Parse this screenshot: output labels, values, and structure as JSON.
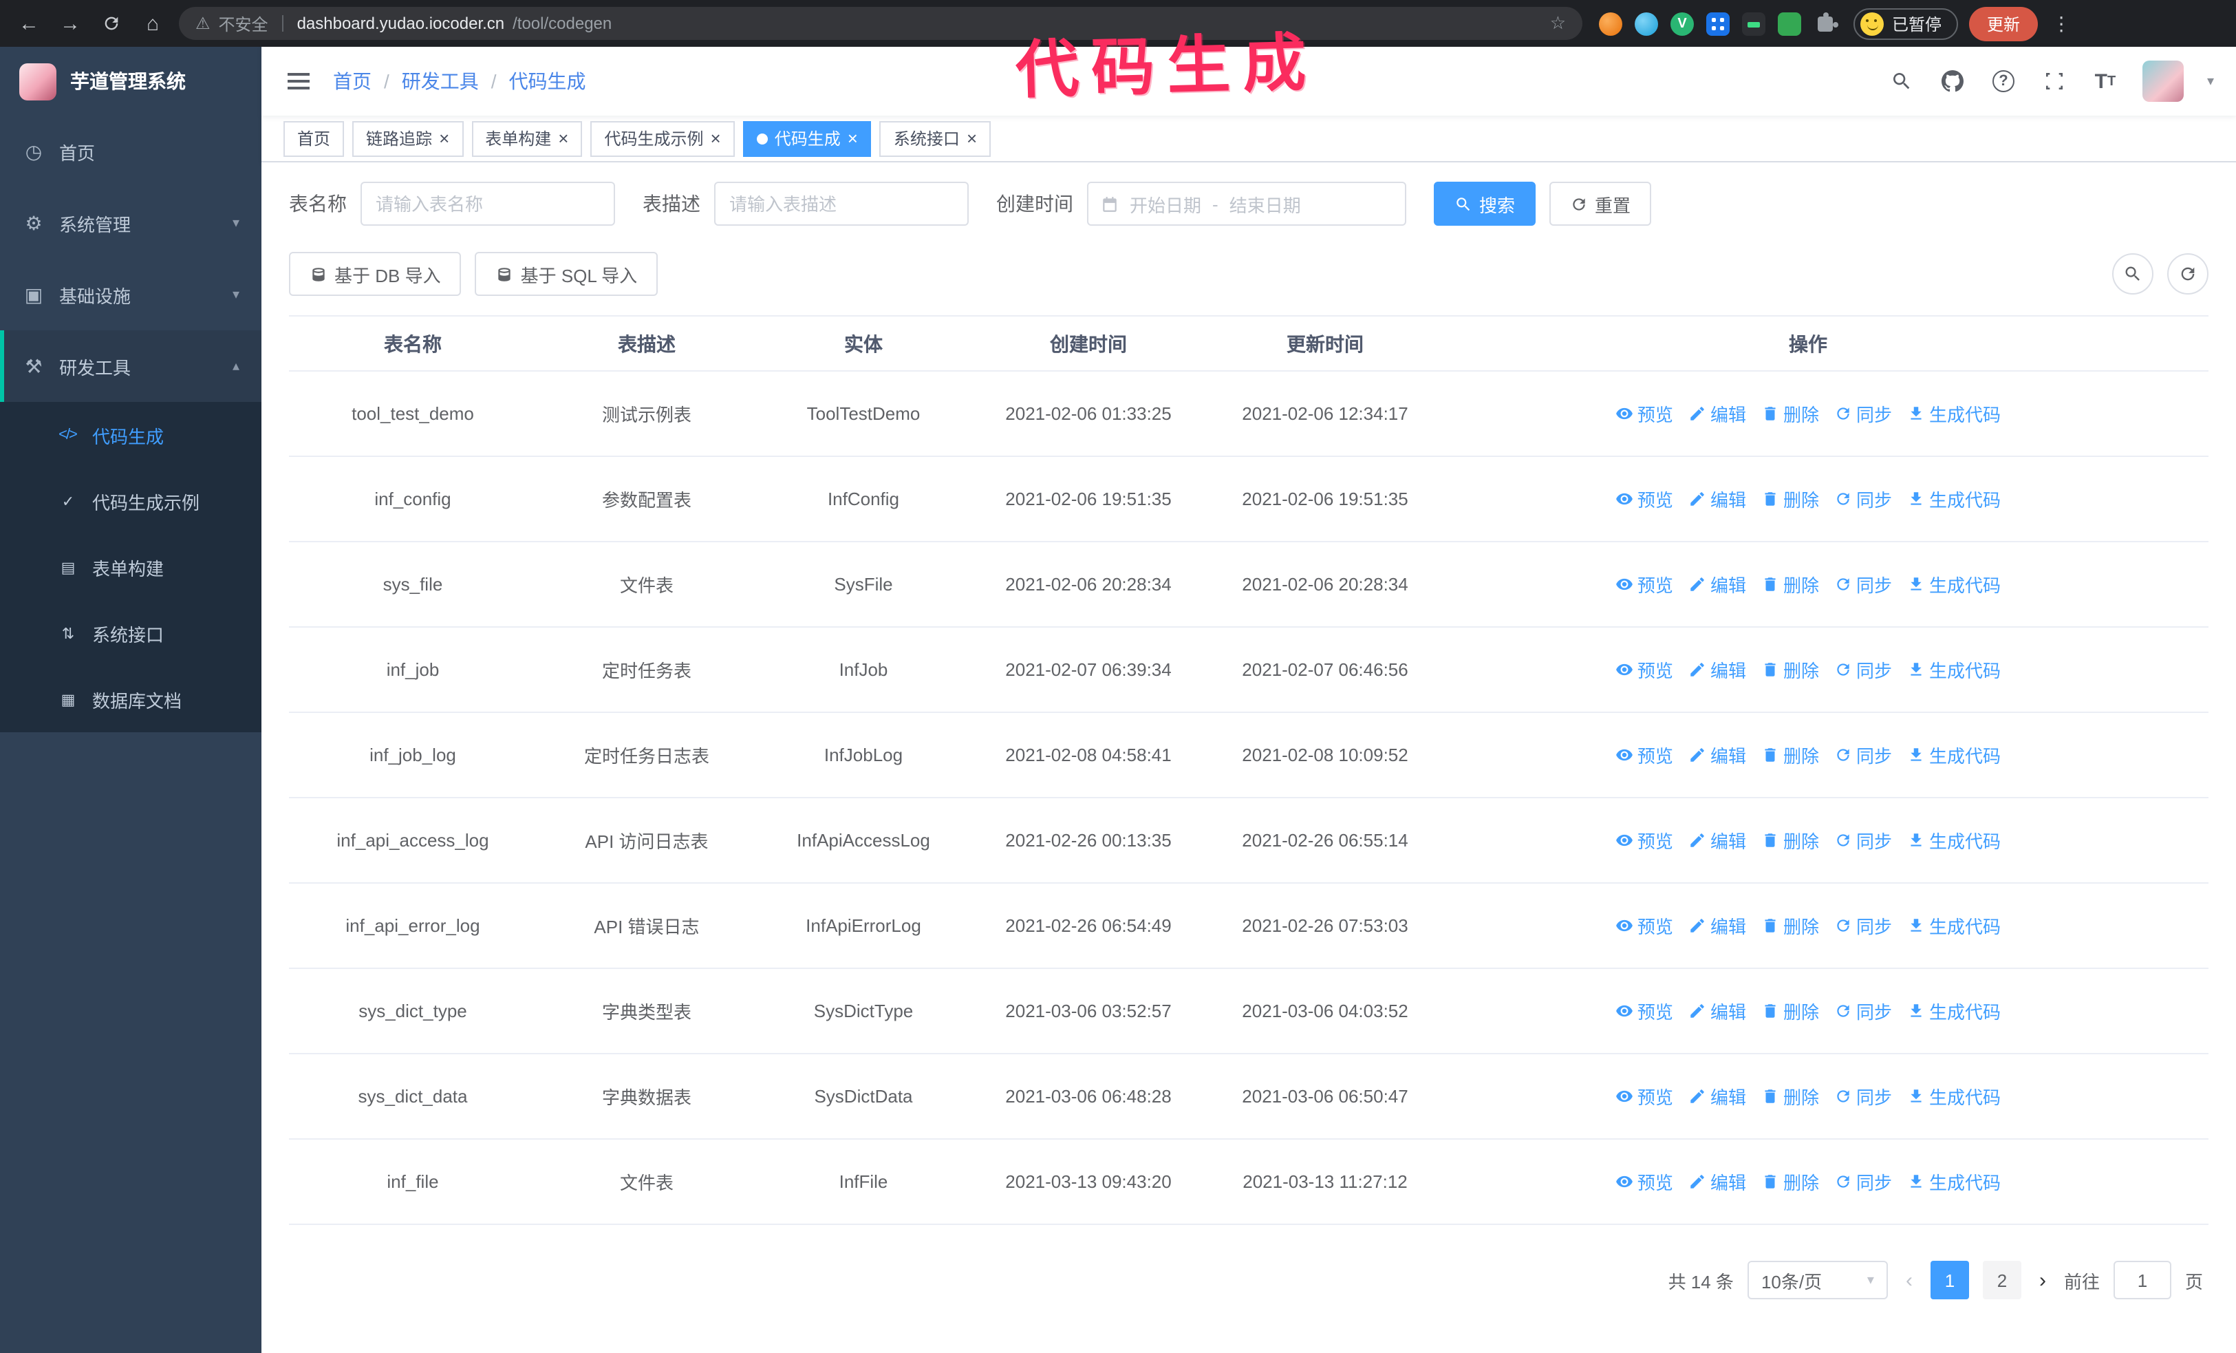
{
  "browser": {
    "security_chip": "不安全",
    "url_host": "dashboard.yudao.iocoder.cn",
    "url_path": "/tool/codegen",
    "paused_badge": "已暂停",
    "update_button": "更新"
  },
  "annotation": {
    "text": "代码生成",
    "color": "#fa2c5e"
  },
  "sidebar": {
    "logo_title": "芋道管理系统",
    "items": [
      {
        "key": "home",
        "label": "首页",
        "icon": "dashboard-icon"
      },
      {
        "key": "system",
        "label": "系统管理",
        "icon": "gear-icon",
        "expandable": true,
        "expanded": false
      },
      {
        "key": "infra",
        "label": "基础设施",
        "icon": "infra-icon",
        "expandable": true,
        "expanded": false
      },
      {
        "key": "devtools",
        "label": "研发工具",
        "icon": "tools-icon",
        "expandable": true,
        "expanded": true,
        "children": [
          {
            "key": "codegen",
            "label": "代码生成",
            "icon": "code-icon",
            "active": true
          },
          {
            "key": "codegen-example",
            "label": "代码生成示例",
            "icon": "example-icon"
          },
          {
            "key": "form-builder",
            "label": "表单构建",
            "icon": "form-icon"
          },
          {
            "key": "system-api",
            "label": "系统接口",
            "icon": "api-icon"
          },
          {
            "key": "db-doc",
            "label": "数据库文档",
            "icon": "db-doc-icon"
          }
        ]
      }
    ]
  },
  "header": {
    "breadcrumb": [
      "首页",
      "研发工具",
      "代码生成"
    ]
  },
  "tabs": [
    {
      "key": "home",
      "label": "首页",
      "closable": false,
      "active": false
    },
    {
      "key": "tracer",
      "label": "链路追踪",
      "closable": true,
      "active": false
    },
    {
      "key": "form-builder",
      "label": "表单构建",
      "closable": true,
      "active": false
    },
    {
      "key": "codegen-example",
      "label": "代码生成示例",
      "closable": true,
      "active": false
    },
    {
      "key": "codegen",
      "label": "代码生成",
      "closable": true,
      "active": true
    },
    {
      "key": "system-api",
      "label": "系统接口",
      "closable": true,
      "active": false
    }
  ],
  "filters": {
    "table_name_label": "表名称",
    "table_name_placeholder": "请输入表名称",
    "table_desc_label": "表描述",
    "table_desc_placeholder": "请输入表描述",
    "create_time_label": "创建时间",
    "date_start_placeholder": "开始日期",
    "date_separator": "-",
    "date_end_placeholder": "结束日期",
    "search_button": "搜索",
    "reset_button": "重置"
  },
  "toolbar": {
    "import_db_button": "基于 DB 导入",
    "import_sql_button": "基于 SQL 导入"
  },
  "table": {
    "columns": [
      "表名称",
      "表描述",
      "实体",
      "创建时间",
      "更新时间",
      "操作"
    ],
    "actions": [
      "预览",
      "编辑",
      "删除",
      "同步",
      "生成代码"
    ],
    "action_icons": [
      "eye-icon",
      "edit-icon",
      "trash-icon",
      "sync-icon",
      "download-icon"
    ],
    "rows": [
      {
        "name": "tool_test_demo",
        "desc": "测试示例表",
        "entity": "ToolTestDemo",
        "create_time": "2021-02-06 01:33:25",
        "update_time": "2021-02-06 12:34:17"
      },
      {
        "name": "inf_config",
        "desc": "参数配置表",
        "entity": "InfConfig",
        "create_time": "2021-02-06 19:51:35",
        "update_time": "2021-02-06 19:51:35"
      },
      {
        "name": "sys_file",
        "desc": "文件表",
        "entity": "SysFile",
        "create_time": "2021-02-06 20:28:34",
        "update_time": "2021-02-06 20:28:34"
      },
      {
        "name": "inf_job",
        "desc": "定时任务表",
        "entity": "InfJob",
        "create_time": "2021-02-07 06:39:34",
        "update_time": "2021-02-07 06:46:56"
      },
      {
        "name": "inf_job_log",
        "desc": "定时任务日志表",
        "entity": "InfJobLog",
        "create_time": "2021-02-08 04:58:41",
        "update_time": "2021-02-08 10:09:52"
      },
      {
        "name": "inf_api_access_log",
        "desc": "API 访问日志表",
        "entity": "InfApiAccessLog",
        "create_time": "2021-02-26 00:13:35",
        "update_time": "2021-02-26 06:55:14"
      },
      {
        "name": "inf_api_error_log",
        "desc": "API 错误日志",
        "entity": "InfApiErrorLog",
        "create_time": "2021-02-26 06:54:49",
        "update_time": "2021-02-26 07:53:03"
      },
      {
        "name": "sys_dict_type",
        "desc": "字典类型表",
        "entity": "SysDictType",
        "create_time": "2021-03-06 03:52:57",
        "update_time": "2021-03-06 04:03:52"
      },
      {
        "name": "sys_dict_data",
        "desc": "字典数据表",
        "entity": "SysDictData",
        "create_time": "2021-03-06 06:48:28",
        "update_time": "2021-03-06 06:50:47"
      },
      {
        "name": "inf_file",
        "desc": "文件表",
        "entity": "InfFile",
        "create_time": "2021-03-13 09:43:20",
        "update_time": "2021-03-13 11:27:12"
      }
    ]
  },
  "pagination": {
    "total_text": "共 14 条",
    "page_size": "10条/页",
    "pages": [
      "1",
      "2"
    ],
    "active_page": "1",
    "goto_label": "前往",
    "goto_value": "1",
    "goto_suffix": "页"
  },
  "colors": {
    "primary": "#409eff",
    "sidebar_bg": "#304156",
    "submenu_bg": "#1f2d3d",
    "annotation_pink": "#fa2c5e",
    "chrome_bar_bg": "#1f2125",
    "update_pill_bg": "#d65745"
  },
  "icons": {
    "browser_nav": [
      "back-icon",
      "forward-icon",
      "reload-icon",
      "home-icon",
      "warning-icon",
      "star-icon"
    ],
    "navbar_right": [
      "search-icon",
      "github-icon",
      "help-icon",
      "fullscreen-icon",
      "text-size-icon",
      "caret-down-icon"
    ],
    "toolbar_right": [
      "search-icon",
      "refresh-icon"
    ]
  }
}
